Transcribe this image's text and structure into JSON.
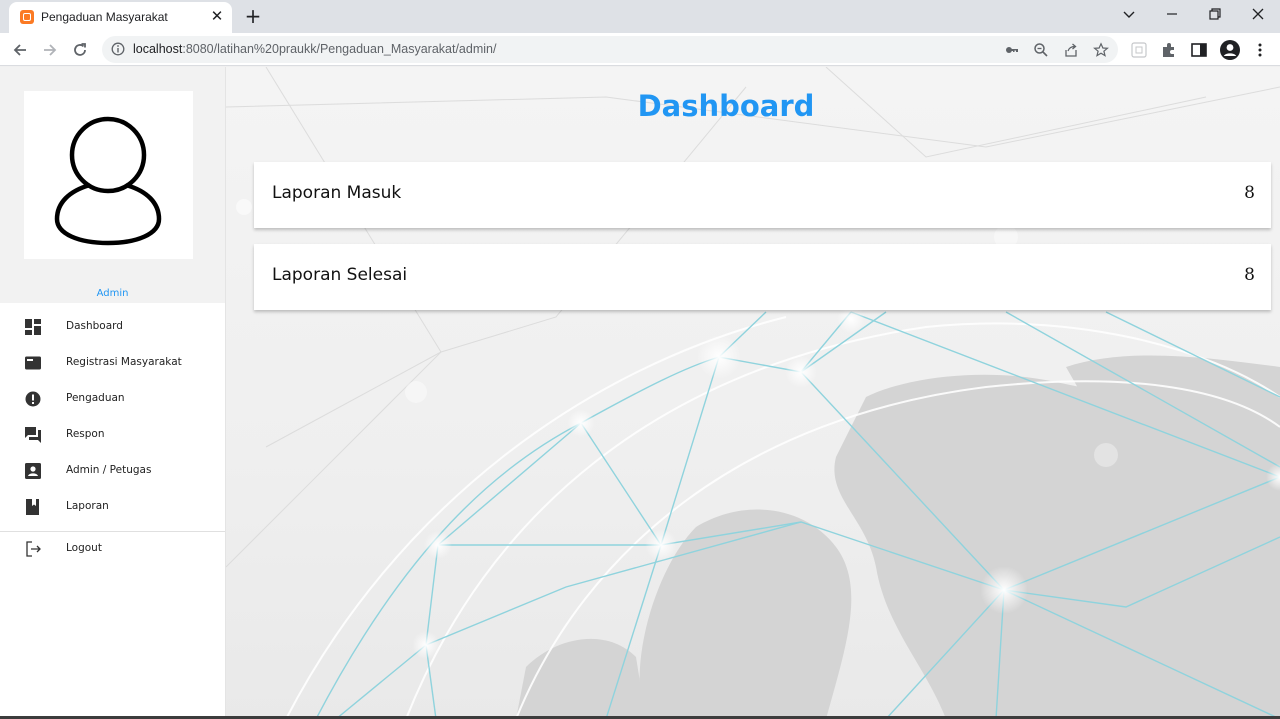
{
  "browser": {
    "tab_title": "Pengaduan Masyarakat",
    "url_host": "localhost",
    "url_rest": ":8080/latihan%20praukk/Pengaduan_Masyarakat/admin/"
  },
  "sidebar": {
    "user_label": "Admin",
    "items": [
      {
        "label": "Dashboard",
        "icon": "dashboard-icon"
      },
      {
        "label": "Registrasi Masyarakat",
        "icon": "card-icon"
      },
      {
        "label": "Pengaduan",
        "icon": "alert-icon"
      },
      {
        "label": "Respon",
        "icon": "forum-icon"
      },
      {
        "label": "Admin / Petugas",
        "icon": "account-box-icon"
      },
      {
        "label": "Laporan",
        "icon": "book-icon"
      }
    ],
    "logout_label": "Logout"
  },
  "main": {
    "title": "Dashboard",
    "cards": [
      {
        "label": "Laporan Masuk",
        "value": "8"
      },
      {
        "label": "Laporan Selesai",
        "value": "8"
      }
    ]
  },
  "colors": {
    "accent": "#2196f3",
    "sidebar_bg": "#ffffff",
    "profile_bg": "#f2f2f2"
  }
}
